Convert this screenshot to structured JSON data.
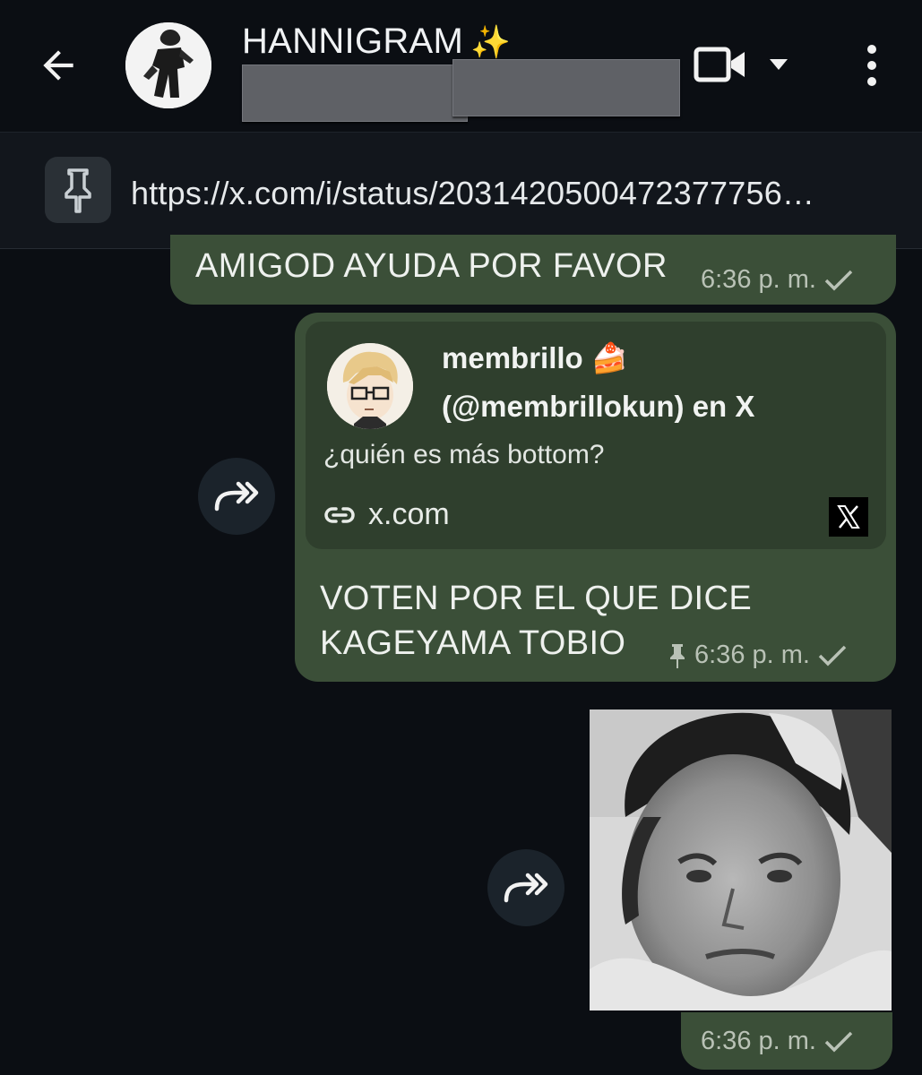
{
  "header": {
    "title": "HANNIGRAM",
    "title_emoji": "✨",
    "back_icon": "arrow-left-icon",
    "video_icon": "video-call-icon",
    "more_icon": "more-vert-icon"
  },
  "pinned": {
    "icon": "pin-icon",
    "url": "https://x.com/i/status/2031420500472377756…"
  },
  "messages": [
    {
      "text": "AMIGOD AYUDA POR FAVOR",
      "time": "6:36 p. m.",
      "status": "sent-check"
    },
    {
      "preview": {
        "name": "membrillo 🍰",
        "handle": "(@membrillokun) en X",
        "description": "¿quién es más bottom?",
        "domain": "x.com"
      },
      "text_line1": "VOTEN POR EL QUE DICE",
      "text_line2": "KAGEYAMA TOBIO",
      "time": "6:36 p. m.",
      "pinned": true
    },
    {
      "type": "image",
      "time": "6:36 p. m."
    }
  ],
  "colors": {
    "background": "#0b0e13",
    "bubble": "#3b4f38",
    "preview": "#2f3f2d",
    "pinbar": "#12161c"
  }
}
